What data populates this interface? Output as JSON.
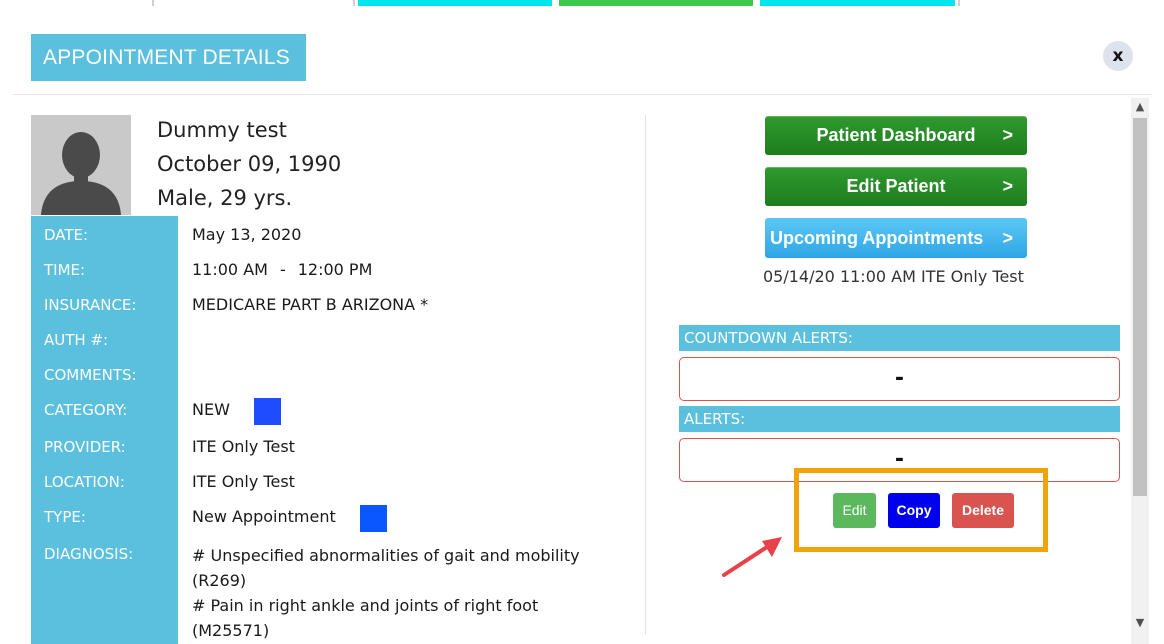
{
  "modal": {
    "title": "APPOINTMENT DETAILS",
    "close_label": "x"
  },
  "patient": {
    "name": "Dummy test",
    "dob": "October 09, 1990",
    "sex_age": "Male, 29 yrs."
  },
  "details": {
    "date_label": "DATE:",
    "date_value": "May 13, 2020",
    "time_label": "TIME:",
    "time_start": "11:00 AM",
    "time_sep": "-",
    "time_end": "12:00 PM",
    "insurance_label": "INSURANCE:",
    "insurance_value": "MEDICARE PART B ARIZONA *",
    "auth_label": "AUTH #:",
    "comments_label": "COMMENTS:",
    "category_label": "CATEGORY:",
    "category_value": "NEW",
    "category_color": "#1f4cff",
    "provider_label": "PROVIDER:",
    "provider_value": "ITE Only Test",
    "location_label": "LOCATION:",
    "location_value": "ITE Only Test",
    "type_label": "TYPE:",
    "type_value": "New Appointment",
    "type_color": "#0b57ff",
    "diagnosis_label": "DIAGNOSIS:",
    "diagnosis_lines": [
      "# Unspecified abnormalities of gait and mobility",
      "(R269)",
      "# Pain in right ankle and joints of right foot",
      "(M25571)"
    ]
  },
  "actions": {
    "patient_dashboard": "Patient Dashboard",
    "edit_patient": "Edit Patient",
    "upcoming_appointments": "Upcoming Appointments",
    "chevron": ">",
    "upcoming_entry": "05/14/20 11:00 AM ITE Only Test"
  },
  "alerts": {
    "countdown_header": "COUNTDOWN ALERTS:",
    "countdown_value": "-",
    "alerts_header": "ALERTS:",
    "alerts_value": "-"
  },
  "buttons": {
    "edit": "Edit",
    "copy": "Copy",
    "delete": "Delete"
  },
  "colors": {
    "accent_cyan": "#5bc0de",
    "green": "#1e7d1e",
    "highlight_orange": "#f0a30a",
    "arrow_red": "#e8414a",
    "tab_cyan": "#00e5ee",
    "tab_green": "#3cc84a"
  },
  "icons": [
    "close-icon",
    "avatar-silhouette-icon",
    "chevron-right-icon",
    "scroll-up-icon",
    "scroll-down-icon",
    "annotation-arrow-icon"
  ]
}
